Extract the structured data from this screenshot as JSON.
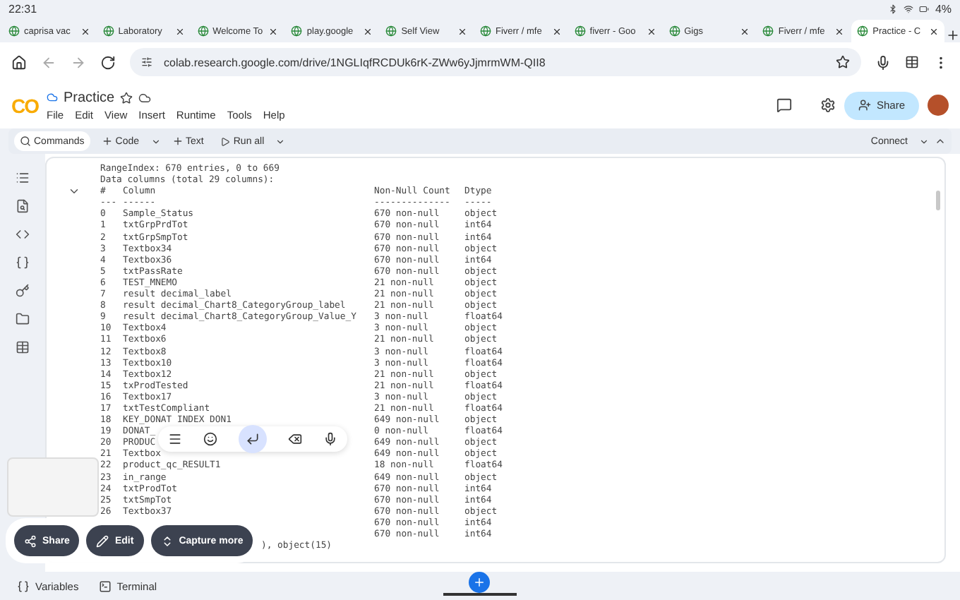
{
  "status_bar": {
    "time": "22:31",
    "battery": "4%"
  },
  "tabs": [
    {
      "title": "caprisa vac",
      "selected": false
    },
    {
      "title": "Laboratory",
      "selected": false
    },
    {
      "title": "Welcome To",
      "selected": false
    },
    {
      "title": "play.google",
      "selected": false
    },
    {
      "title": "Self View",
      "selected": false
    },
    {
      "title": "Fiverr / mfe",
      "selected": false
    },
    {
      "title": "fiverr - Goo",
      "selected": false
    },
    {
      "title": "Gigs",
      "selected": false
    },
    {
      "title": "Fiverr / mfe",
      "selected": false
    },
    {
      "title": "Practice - C",
      "selected": true
    }
  ],
  "address_bar": {
    "url": "colab.research.google.com/drive/1NGLIqfRCDUk6rK-ZWw6yJjmrmWM-QII8"
  },
  "notebook": {
    "logo": "CO",
    "title": "Practice",
    "menu": [
      "File",
      "Edit",
      "View",
      "Insert",
      "Runtime",
      "Tools",
      "Help"
    ],
    "share": "Share"
  },
  "toolbar": {
    "commands": "Commands",
    "code": "Code",
    "text": "Text",
    "run_all": "Run all",
    "connect": "Connect"
  },
  "output": {
    "lines": [
      "RangeIndex: 670 entries, 0 to 669",
      "Data columns (total 29 columns):"
    ],
    "header": {
      "index": "#",
      "column": "Column",
      "count": "Non-Null Count",
      "dtype": "Dtype"
    },
    "rule": {
      "index": "---",
      "column": "------",
      "count": "--------------",
      "dtype": "-----"
    },
    "rows": [
      {
        "index": "0",
        "column": "Sample_Status",
        "count": "670 non-null",
        "dtype": "object"
      },
      {
        "index": "1",
        "column": "txtGrpPrdTot",
        "count": "670 non-null",
        "dtype": "int64"
      },
      {
        "index": "2",
        "column": "txtGrpSmpTot",
        "count": "670 non-null",
        "dtype": "int64"
      },
      {
        "index": "3",
        "column": "Textbox34",
        "count": "670 non-null",
        "dtype": "object"
      },
      {
        "index": "4",
        "column": "Textbox36",
        "count": "670 non-null",
        "dtype": "int64"
      },
      {
        "index": "5",
        "column": "txtPassRate",
        "count": "670 non-null",
        "dtype": "object"
      },
      {
        "index": "6",
        "column": "TEST_MNEMO",
        "count": "21 non-null",
        "dtype": "object"
      },
      {
        "index": "7",
        "column": "result decimal_label",
        "count": "21 non-null",
        "dtype": "object"
      },
      {
        "index": "8",
        "column": "result decimal_Chart8_CategoryGroup_label",
        "count": "21 non-null",
        "dtype": "object"
      },
      {
        "index": "9",
        "column": "result decimal_Chart8_CategoryGroup_Value_Y",
        "count": "3 non-null",
        "dtype": "float64"
      },
      {
        "index": "10",
        "column": "Textbox4",
        "count": "3 non-null",
        "dtype": "object"
      },
      {
        "index": "11",
        "column": "Textbox6",
        "count": "21 non-null",
        "dtype": "object"
      },
      {
        "index": "12",
        "column": "Textbox8",
        "count": "3 non-null",
        "dtype": "float64"
      },
      {
        "index": "13",
        "column": "Textbox10",
        "count": "3 non-null",
        "dtype": "float64"
      },
      {
        "index": "14",
        "column": "Textbox12",
        "count": "21 non-null",
        "dtype": "object"
      },
      {
        "index": "15",
        "column": "txProdTested",
        "count": "21 non-null",
        "dtype": "float64"
      },
      {
        "index": "16",
        "column": "Textbox17",
        "count": "3 non-null",
        "dtype": "object"
      },
      {
        "index": "17",
        "column": "txtTestCompliant",
        "count": "21 non-null",
        "dtype": "float64"
      },
      {
        "index": "18",
        "column": "KEY_DONAT INDEX DON1",
        "count": "649 non-null",
        "dtype": "object"
      },
      {
        "index": "19",
        "column": "DONAT_",
        "count": "0 non-null",
        "dtype": "float64"
      },
      {
        "index": "20",
        "column": "PRODUC",
        "count": "649 non-null",
        "dtype": "object"
      },
      {
        "index": "21",
        "column": "Textbox",
        "count": "649 non-null",
        "dtype": "object"
      },
      {
        "index": "22",
        "column": "product_qc_RESULT1",
        "count": "18 non-null",
        "dtype": "float64"
      },
      {
        "index": "23",
        "column": "in_range",
        "count": "649 non-null",
        "dtype": "object"
      },
      {
        "index": "24",
        "column": "txtProdTot",
        "count": "670 non-null",
        "dtype": "int64"
      },
      {
        "index": "25",
        "column": "txtSmpTot",
        "count": "670 non-null",
        "dtype": "int64"
      },
      {
        "index": "26",
        "column": "Textbox37",
        "count": "670 non-null",
        "dtype": "object"
      },
      {
        "count": "670 non-null",
        "dtype": "int64"
      },
      {
        "count": "670 non-null",
        "dtype": "int64"
      }
    ],
    "footer": "), object(15)"
  },
  "screenshot_actions": [
    {
      "kind": "share",
      "label": "Share"
    },
    {
      "kind": "edit",
      "label": "Edit"
    },
    {
      "kind": "capture",
      "label": "Capture more"
    }
  ],
  "bottom_bar": [
    {
      "kind": "variables",
      "label": "Variables"
    },
    {
      "kind": "terminal",
      "label": "Terminal"
    }
  ]
}
